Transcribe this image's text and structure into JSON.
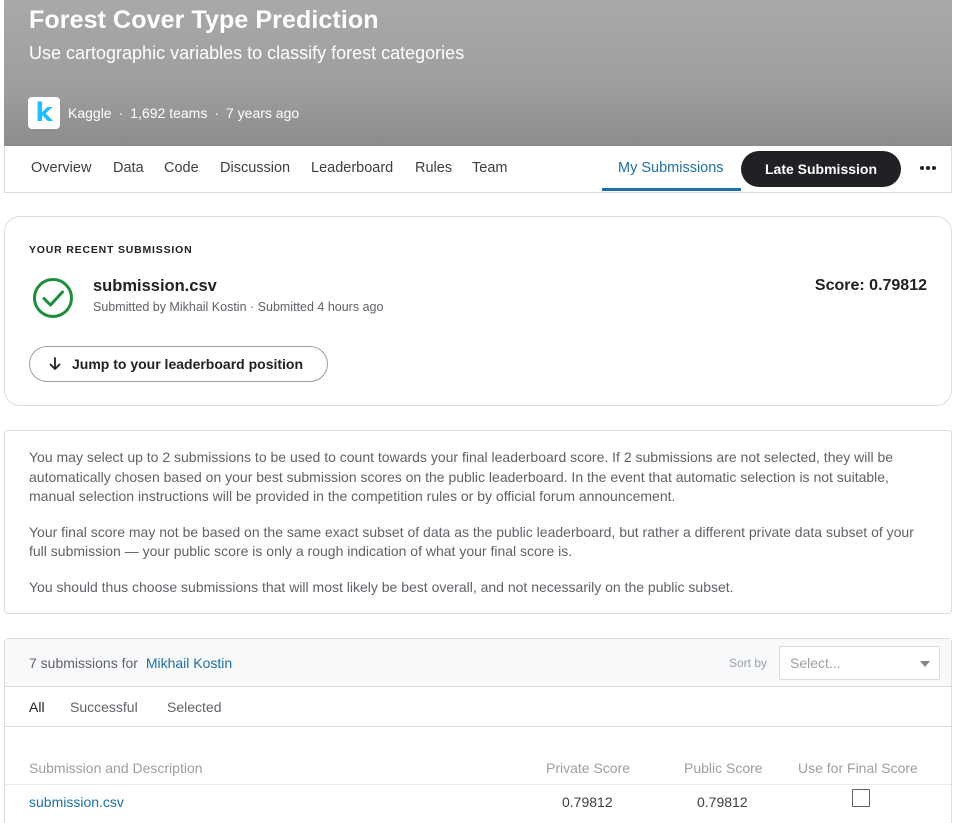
{
  "header": {
    "title": "Forest Cover Type Prediction",
    "subtitle": "Use cartographic variables to classify forest categories",
    "logo_letter": "k",
    "host": "Kaggle",
    "teams": "1,692 teams",
    "age": "7 years ago",
    "separator": "·"
  },
  "tabs": {
    "items": [
      "Overview",
      "Data",
      "Code",
      "Discussion",
      "Leaderboard",
      "Rules",
      "Team",
      "My Submissions"
    ],
    "active": "My Submissions",
    "late_submission": "Late Submission"
  },
  "recent": {
    "label": "YOUR RECENT SUBMISSION",
    "file": "submission.csv",
    "submitted_by": "Submitted by Mikhail Kostin · Submitted 4 hours ago",
    "score": "Score: 0.79812",
    "jump_label": "Jump to your leaderboard position",
    "status_icon": "check-circle-icon"
  },
  "info": {
    "p1": "You may select up to 2 submissions to be used to count towards your final leaderboard score. If 2 submissions are not selected, they will be automatically chosen based on your best submission scores on the public leaderboard. In the event that automatic selection is not suitable, manual selection instructions will be provided in the competition rules or by official forum announcement.",
    "p2": "Your final score may not be based on the same exact subset of data as the public leaderboard, but rather a different private data subset of your full submission — your public score is only a rough indication of what your final score is.",
    "p3": "You should thus choose submissions that will most likely be best overall, and not necessarily on the public subset."
  },
  "submissions": {
    "count_text": "7 submissions for",
    "user": "Mikhail Kostin",
    "sort_label": "Sort by",
    "sort_placeholder": "Select...",
    "filters": [
      "All",
      "Successful",
      "Selected"
    ],
    "active_filter": "All",
    "columns": [
      "Submission and Description",
      "Private Score",
      "Public Score",
      "Use for Final Score"
    ],
    "rows": [
      {
        "file": "submission.csv",
        "private": "0.79812",
        "public": "0.79812",
        "final": false
      }
    ]
  },
  "colors": {
    "accent": "#1f6fa8",
    "success": "#1e8e3e",
    "dark_button": "#202124"
  }
}
